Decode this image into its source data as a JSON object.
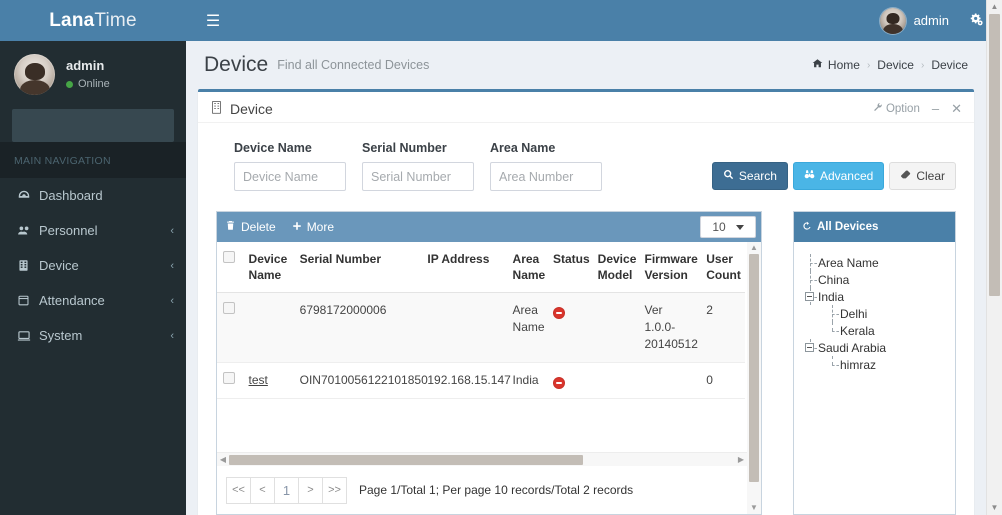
{
  "brand": {
    "bold": "Lana",
    "light": "Time"
  },
  "sidebar": {
    "user": {
      "name": "admin",
      "status": "Online"
    },
    "search_placeholder": "",
    "nav_header": "MAIN NAVIGATION",
    "items": [
      {
        "label": "Dashboard",
        "icon": "dashboard-icon",
        "arrow": ""
      },
      {
        "label": "Personnel",
        "icon": "users-icon",
        "arrow": "‹"
      },
      {
        "label": "Device",
        "icon": "server-icon",
        "arrow": "‹"
      },
      {
        "label": "Attendance",
        "icon": "calendar-icon",
        "arrow": "‹"
      },
      {
        "label": "System",
        "icon": "desktop-icon",
        "arrow": "‹"
      }
    ]
  },
  "topbar": {
    "menu_toggle": "☰",
    "user_label": "admin",
    "gear": "gear-icon"
  },
  "header": {
    "title": "Device",
    "subtitle": "Find all Connected Devices",
    "breadcrumb": [
      "Home",
      "Device",
      "Device"
    ],
    "separator": "›"
  },
  "box": {
    "title": "Device",
    "option_label": "Option",
    "minimize": "–",
    "close": "✕"
  },
  "filters": {
    "fields": [
      {
        "label": "Device Name",
        "placeholder": "Device Name",
        "value": ""
      },
      {
        "label": "Serial Number",
        "placeholder": "Serial Number",
        "value": ""
      },
      {
        "label": "Area Name",
        "placeholder": "Area Number",
        "value": ""
      }
    ],
    "buttons": {
      "search": "Search",
      "advanced": "Advanced",
      "clear": "Clear"
    }
  },
  "table": {
    "toolbar": {
      "delete": "Delete",
      "more": "More",
      "per_page": "10"
    },
    "columns": [
      "Device Name",
      "Serial Number",
      "IP Address",
      "Area Name",
      "Status",
      "Device Model",
      "Firmware Version",
      "User Count"
    ],
    "rows": [
      {
        "device_name": "",
        "serial_number": "6798172000006",
        "ip_address": "",
        "area_name": "Area Name",
        "status": "disabled",
        "device_model": "",
        "firmware_version": "Ver 1.0.0-20140512",
        "user_count": "2"
      },
      {
        "device_name": "test",
        "serial_number": "OIN7010056122101850",
        "ip_address": "192.168.15.147",
        "area_name": "India",
        "status": "disabled",
        "device_model": "",
        "firmware_version": "",
        "user_count": "0"
      }
    ],
    "pager": {
      "first": "<<",
      "prev": "<",
      "current": "1",
      "next": ">",
      "last": ">>",
      "info": "Page 1/Total 1; Per page 10 records/Total 2 records"
    }
  },
  "tree": {
    "title": "All Devices",
    "nodes": [
      {
        "label": "Area Name",
        "level": 1,
        "expander": false
      },
      {
        "label": "China",
        "level": 1,
        "expander": false
      },
      {
        "label": "India",
        "level": 1,
        "expander": true
      },
      {
        "label": "Delhi",
        "level": 2,
        "expander": false
      },
      {
        "label": "Kerala",
        "level": 2,
        "expander": false
      },
      {
        "label": "Saudi Arabia",
        "level": 1,
        "expander": true
      },
      {
        "label": "himraz",
        "level": 2,
        "expander": false
      }
    ]
  },
  "colors": {
    "brand_blue": "#4a80a8",
    "sidebar_dark": "#222d32",
    "accent_cyan": "#4ab5e6",
    "status_red": "#d9352c",
    "online_green": "#46a546"
  }
}
